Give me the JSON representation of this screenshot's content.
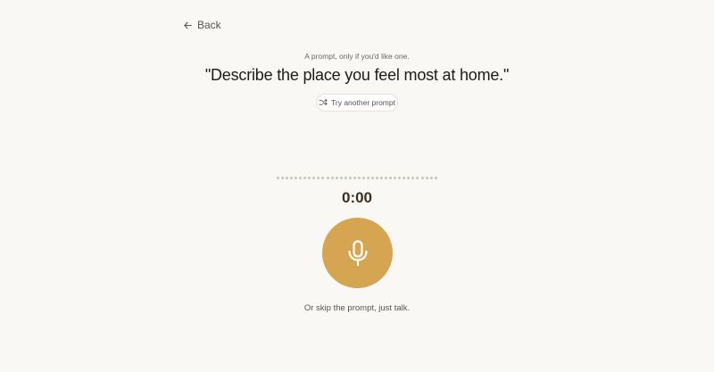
{
  "nav": {
    "back_label": "Back",
    "back_icon": "arrow-left-icon"
  },
  "prompt": {
    "intro": "A prompt, only if you'd like one.",
    "text": "\"Describe the place you feel most at home.\"",
    "try_another_label": "Try another prompt",
    "try_another_icon": "shuffle-icon"
  },
  "recorder": {
    "waveform_dot_count": 36,
    "timer": "0:00",
    "mic_icon": "microphone-icon",
    "skip_text": "Or skip the prompt, just talk."
  },
  "colors": {
    "background": "#faf8f5",
    "accent": "#d5a552",
    "timer_text": "#3b2e22",
    "waveform_dot": "#c9c4bd"
  }
}
